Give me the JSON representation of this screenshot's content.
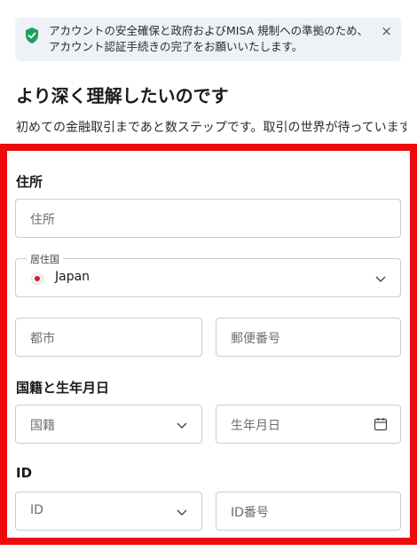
{
  "notice": {
    "message": "アカウントの安全確保と政府およびMISA 規制への準拠のため、アカウント認証手続きの完了をお願いいたします。",
    "close_label": "×"
  },
  "page": {
    "title": "より深く理解したいのです",
    "intro": "初めての金融取引まであと数ステップです。取引の世界が待っています。"
  },
  "form": {
    "address_section": "住所",
    "address_placeholder": "住所",
    "country_label": "居住国",
    "country_value": "Japan",
    "city_placeholder": "都市",
    "postal_placeholder": "郵便番号",
    "nationality_section": "国籍と生年月日",
    "nationality_placeholder": "国籍",
    "birthdate_placeholder": "生年月日",
    "id_section": "ID",
    "id_type_placeholder": "ID",
    "id_number_placeholder": "ID番号"
  },
  "colors": {
    "highlight_frame": "#ee0a0a",
    "shield": "#1e9e5a",
    "japan_flag": "#d61a2e"
  },
  "icons": [
    "shield-check-icon",
    "close-icon",
    "japan-flag-icon",
    "chevron-down-icon",
    "calendar-icon"
  ]
}
